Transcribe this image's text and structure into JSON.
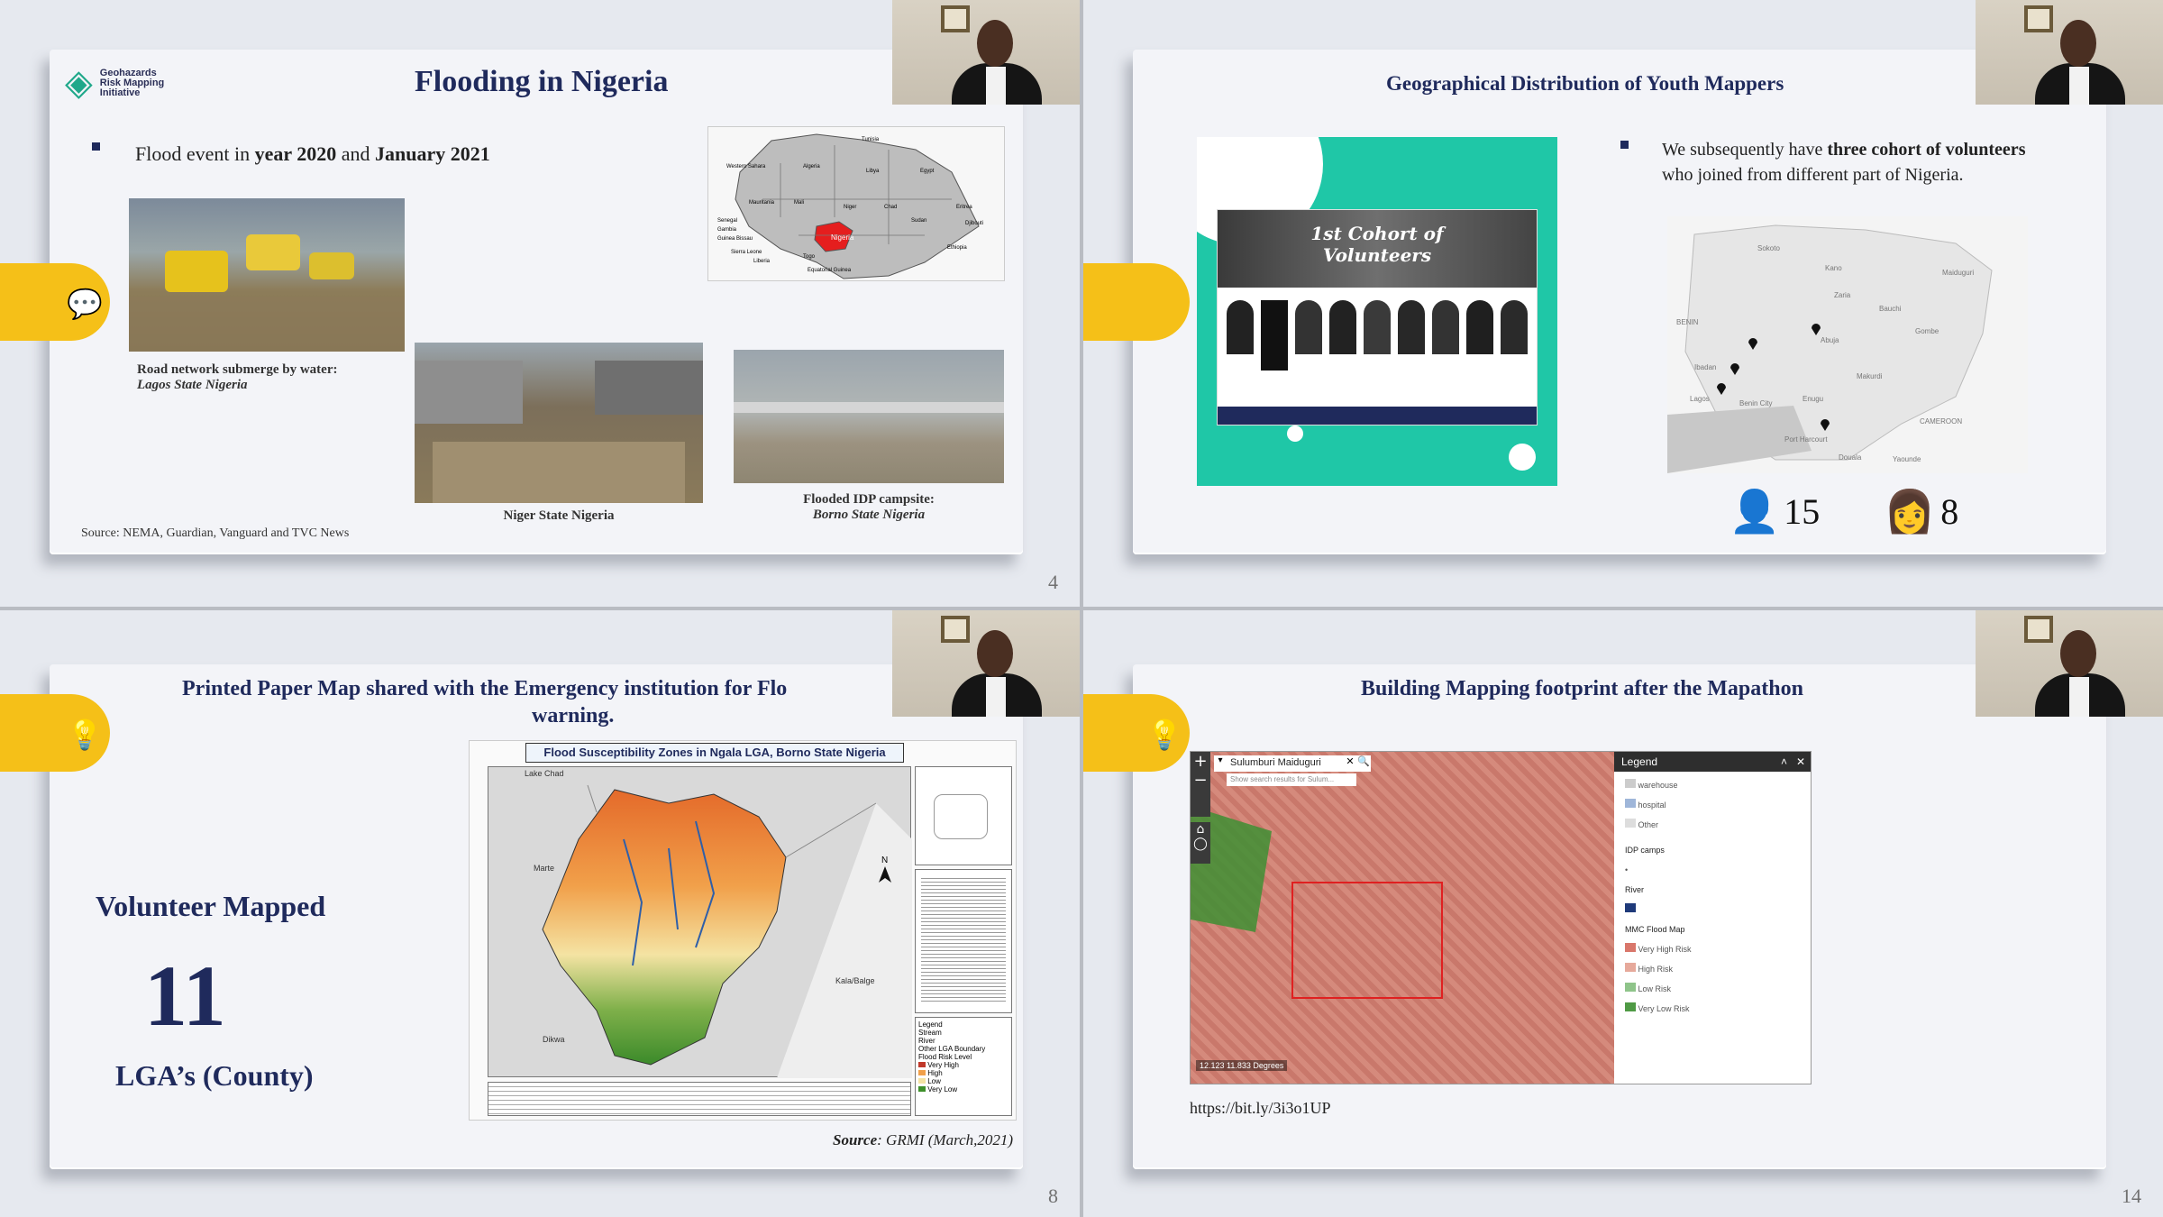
{
  "q1": {
    "logo_text": "Geohazards Risk Mapping Initiative",
    "title": "Flooding in Nigeria",
    "bullet_pre": "Flood event in ",
    "bullet_b1": "year 2020",
    "bullet_mid": " and ",
    "bullet_b2": "January 2021",
    "cap1_line1": "Road network submerge by water:",
    "cap1_line2": "Lagos State Nigeria",
    "cap2": "Niger State Nigeria",
    "cap3_line1": "Flooded IDP campsite:",
    "cap3_line2": "Borno State Nigeria",
    "source": "Source: NEMA, Guardian, Vanguard and TVC News",
    "page": "4",
    "africa_labels": [
      "Nigeria",
      "Tunisia",
      "Western Sahara",
      "Algeria",
      "Libya",
      "Egypt",
      "Mauritania",
      "Mali",
      "Niger",
      "Chad",
      "Sudan",
      "Eritrea",
      "Djibouti",
      "Senegal",
      "Gambia",
      "Guinea Bissau",
      "Sierra Leone",
      "Liberia",
      "Togo",
      "Ethiopia",
      "Equatorial Guinea"
    ]
  },
  "q2": {
    "title": "Geographical Distribution of Youth Mappers",
    "bullet_pre": "We subsequently have ",
    "bullet_b": "three cohort of volunteers",
    "bullet_post": " who joined from different part of Nigeria.",
    "cohort_title1": "1st Cohort of",
    "cohort_title2": "Volunteers",
    "male_count": "15",
    "female_count": "8",
    "map_labels": [
      "Sokoto",
      "Kano",
      "Maiduguri",
      "Zaria",
      "Bauchi",
      "Abuja",
      "Gombe",
      "Ibadan",
      "Lagos",
      "Benin City",
      "Enugu",
      "Makurdi",
      "Port Harcourt",
      "Douala",
      "Yaounde",
      "BENIN",
      "CAMEROON"
    ]
  },
  "q3": {
    "title_line1": "Printed Paper Map shared with the Emergency institution for Flo",
    "title_line2": "warning.",
    "vol_label": "Volunteer Mapped",
    "count": "11",
    "lga": "LGA’s (County)",
    "map_title": "Flood Susceptibility Zones in Ngala LGA, Borno State Nigeria",
    "legend_items": [
      "Stream",
      "River",
      "Other LGA Boundary",
      "Very High",
      "High",
      "Low",
      "Very Low"
    ],
    "legend_title": "Legend",
    "flood_level": "Flood Risk Level",
    "source_label": "Source",
    "source_text": ": GRMI (March,2021)",
    "page": "8"
  },
  "q4": {
    "title": "Building Mapping footprint after the Mapathon",
    "search_value": "Sulumburi Maiduguri",
    "search_hint": "Show search results for Sulum...",
    "legend_title": "Legend",
    "legend_top": [
      "warehouse",
      "hospital",
      "Other"
    ],
    "idp": "IDP camps",
    "river": "River",
    "mmc": "MMC Flood Map",
    "risk": [
      "Very High Risk",
      "High Risk",
      "Low Risk",
      "Very Low Risk"
    ],
    "scale": "12.123 11.833 Degrees",
    "url": "https://bit.ly/3i3o1UP",
    "page": "14"
  },
  "colors": {
    "accent": "#f5c018",
    "title": "#1f2a5c",
    "teal": "#1fc7a7",
    "flood_high": "#c0392b",
    "flood_low": "#3d8f2a"
  }
}
